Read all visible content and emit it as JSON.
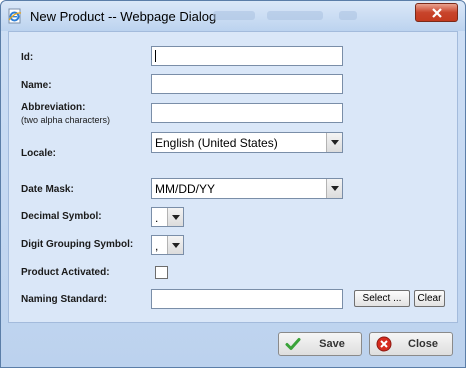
{
  "window": {
    "title": "New Product -- Webpage Dialog"
  },
  "form": {
    "id_label": "Id:",
    "id_value": "",
    "name_label": "Name:",
    "name_value": "",
    "abbreviation_label": "Abbreviation:",
    "abbreviation_hint": "(two alpha characters)",
    "abbreviation_value": "",
    "locale_label": "Locale:",
    "locale_value": "English (United States)",
    "date_mask_label": "Date Mask:",
    "date_mask_value": "MM/DD/YY",
    "decimal_symbol_label": "Decimal Symbol:",
    "decimal_symbol_value": ".",
    "digit_grouping_label": "Digit Grouping Symbol:",
    "digit_grouping_value": ",",
    "product_activated_label": "Product Activated:",
    "product_activated_checked": false,
    "naming_standard_label": "Naming Standard:",
    "naming_standard_value": "",
    "select_button": "Select ...",
    "clear_button": "Clear"
  },
  "footer": {
    "save_button": "Save",
    "close_button": "Close"
  },
  "colors": {
    "window_frame": "#bcd2ee",
    "panel_background": "#dae7f8",
    "save_icon": "#3aa33a",
    "close_icon": "#d62b1e"
  },
  "icons": {
    "app": "ie-page-icon",
    "window_close": "close-x-icon",
    "save": "checkmark-icon",
    "close": "cancel-circle-icon"
  }
}
